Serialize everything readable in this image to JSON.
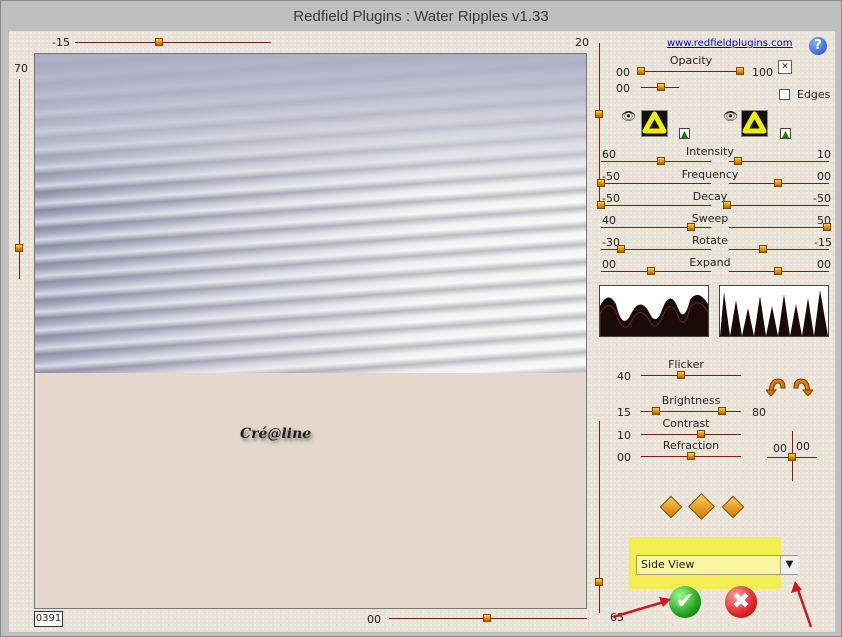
{
  "window": {
    "title": "Redfield Plugins : Water Ripples v1.33"
  },
  "link": "www.redfieldplugins.com",
  "help_label": "?",
  "preview": {
    "top_slider": {
      "min": "-15",
      "max": "20"
    },
    "left_slider_value": "70",
    "bottom_slider_value": "00",
    "right_vertical_value": "65",
    "counter": "0391",
    "watermark": "Cré@line"
  },
  "opacity": {
    "label": "Opacity",
    "left": "00",
    "right": "100",
    "second": "00"
  },
  "edges": {
    "label": "Edges"
  },
  "params": [
    {
      "label": "Intensity",
      "left": "60",
      "right": "10"
    },
    {
      "label": "Frequency",
      "left": "-50",
      "right": "00"
    },
    {
      "label": "Decay",
      "left": "-50",
      "right": "-50"
    },
    {
      "label": "Sweep",
      "left": "40",
      "right": "50"
    },
    {
      "label": "Rotate",
      "left": "-30",
      "right": "-15"
    },
    {
      "label": "Expand",
      "left": "00",
      "right": "00"
    }
  ],
  "lighting": {
    "flicker": {
      "label": "Flicker",
      "value": "40"
    },
    "brightness": {
      "label": "Brightness",
      "left": "15",
      "right": "80"
    },
    "contrast": {
      "label": "Contrast",
      "value": "10"
    },
    "refraction": {
      "label": "Refraction",
      "value": "00"
    }
  },
  "position": {
    "x": "00",
    "y": "00"
  },
  "view_select": {
    "selected": "Side View"
  },
  "colors": {
    "track": "#7a1e12",
    "thumb": "#e08a00",
    "highlight": "#f2ee52",
    "annotation": "#d0161c"
  }
}
